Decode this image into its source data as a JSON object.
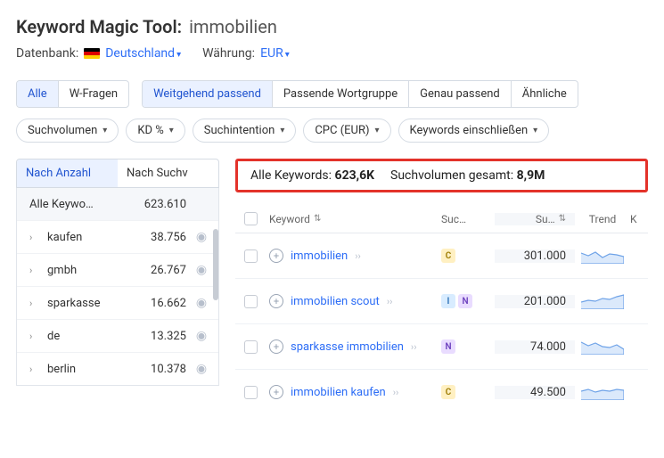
{
  "header": {
    "tool_name": "Keyword Magic Tool:",
    "keyword": "immobilien",
    "db_label": "Datenbank:",
    "db_value": "Deutschland",
    "currency_label": "Währung:",
    "currency_value": "EUR"
  },
  "match_tabs": {
    "all": "Alle",
    "questions": "W-Fragen",
    "broad": "Weitgehend passend",
    "phrase": "Passende Wortgruppe",
    "exact": "Genau passend",
    "related": "Ähnliche"
  },
  "filters": {
    "volume": "Suchvolumen",
    "kd": "KD %",
    "intent": "Suchintention",
    "cpc": "CPC (EUR)",
    "include": "Keywords einschließen"
  },
  "left_panel": {
    "tab_count": "Nach Anzahl",
    "tab_volume": "Nach Suchv",
    "all_label": "Alle Keywo…",
    "all_count": "623.610",
    "groups": [
      {
        "name": "kaufen",
        "count": "38.756"
      },
      {
        "name": "gmbh",
        "count": "26.767"
      },
      {
        "name": "sparkasse",
        "count": "16.662"
      },
      {
        "name": "de",
        "count": "13.325"
      },
      {
        "name": "berlin",
        "count": "10.378"
      }
    ]
  },
  "summary": {
    "all_kw_label": "Alle Keywords:",
    "all_kw_value": "623,6K",
    "total_vol_label": "Suchvolumen gesamt:",
    "total_vol_value": "8,9M"
  },
  "table": {
    "headers": {
      "keyword": "Keyword",
      "intent": "Suc…",
      "volume": "Su…",
      "trend": "Trend",
      "last": "K"
    },
    "rows": [
      {
        "keyword": "immobilien",
        "intents": [
          "C"
        ],
        "volume": "301.000"
      },
      {
        "keyword": "immobilien scout",
        "intents": [
          "I",
          "N"
        ],
        "volume": "201.000"
      },
      {
        "keyword": "sparkasse immobilien",
        "intents": [
          "N"
        ],
        "volume": "74.000"
      },
      {
        "keyword": "immobilien kaufen",
        "intents": [
          "C"
        ],
        "volume": "49.500"
      }
    ]
  }
}
